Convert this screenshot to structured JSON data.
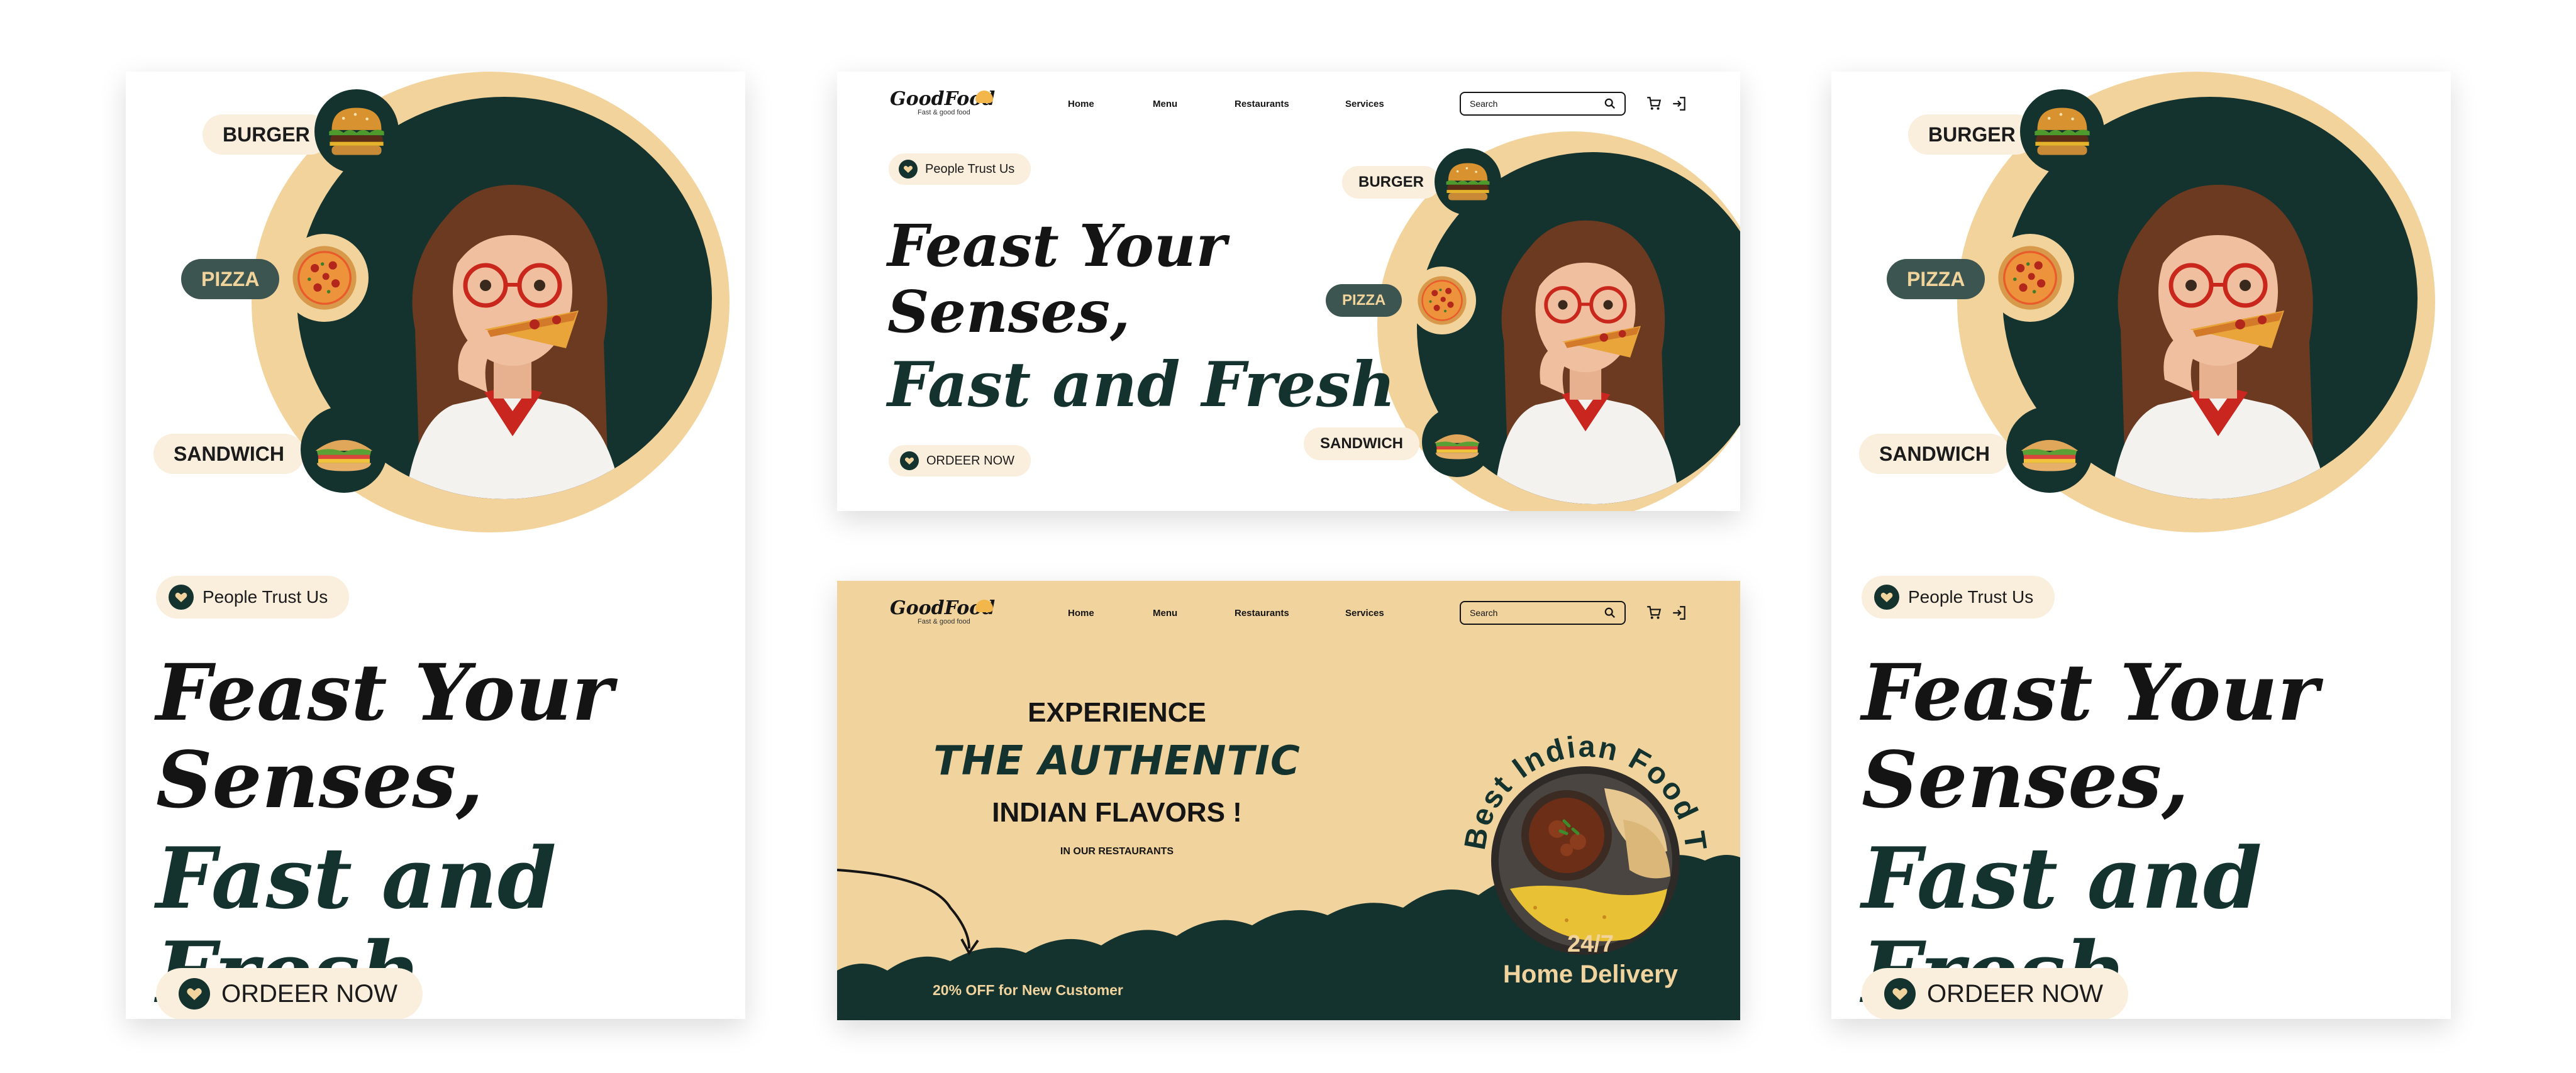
{
  "colors": {
    "accent_green": "#15332e",
    "cream": "#f2d39c",
    "pill_bg": "#faeedd"
  },
  "hero": {
    "trust_label": "People Trust Us",
    "headline_line1": "Feast Your",
    "headline_line2": "Senses,",
    "headline_line3": "Fast and Fresh",
    "order_label": "ORDEER NOW",
    "categories": {
      "burger": "BURGER",
      "pizza": "PIZZA",
      "sandwich": "SANDWICH"
    }
  },
  "nav": {
    "brand": "GoodFood",
    "tagline": "Fast & good food",
    "items": [
      "Home",
      "Menu",
      "Restaurants",
      "Services"
    ],
    "search_placeholder": "Search",
    "icons": [
      "search-icon",
      "cart-icon",
      "login-icon"
    ]
  },
  "promo": {
    "line1": "EXPERIENCE",
    "line2": "THE AUTHENTIC",
    "line3": "INDIAN FLAVORS !",
    "line4": "IN OUR RESTAURANTS",
    "badge": "Best Indian Food Taste",
    "discount": "20% OFF for New Customer",
    "delivery_line1": "24/7",
    "delivery_line2": "Home Delivery"
  }
}
